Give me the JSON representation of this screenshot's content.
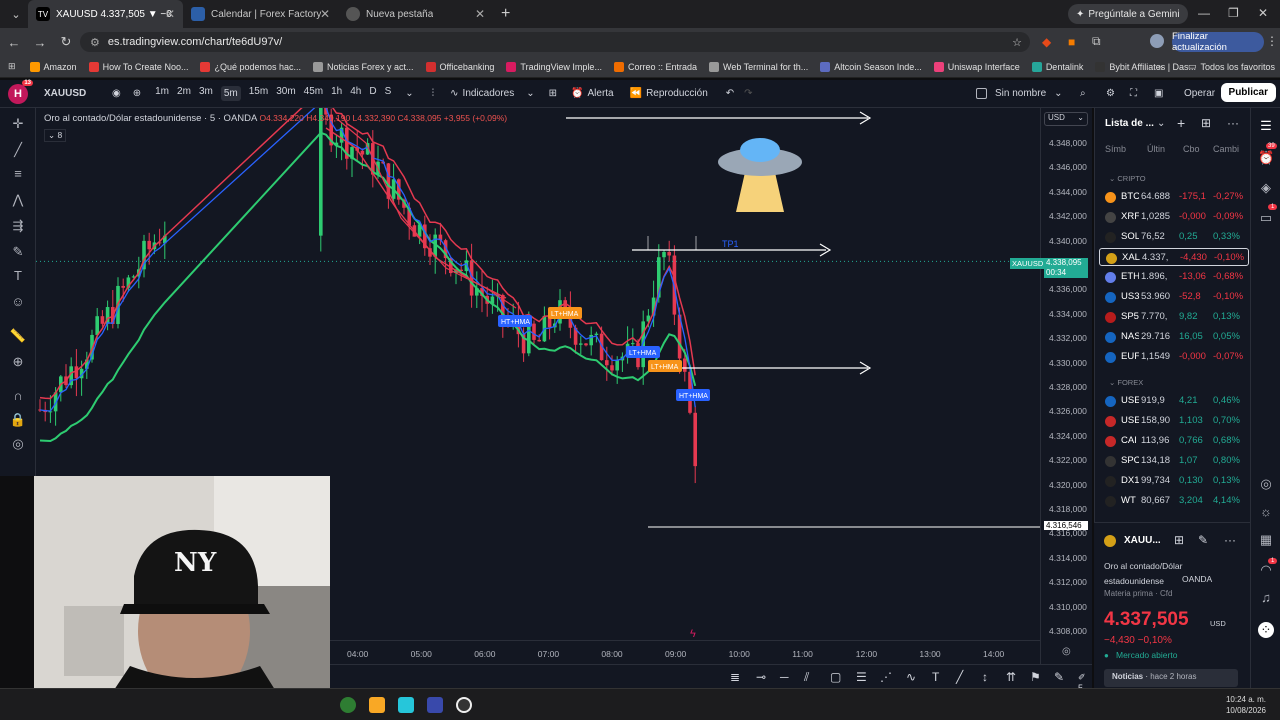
{
  "browser": {
    "tabs": [
      {
        "label": "XAUUSD 4.337,505 ▼ −0.1% Si",
        "active": true,
        "color": "#fff"
      },
      {
        "label": "Calendar | Forex Factory",
        "active": false,
        "color": "#2c5fa8"
      },
      {
        "label": "Nueva pestaña",
        "active": false,
        "color": "#777"
      }
    ],
    "new_tab": "+",
    "gemini": "Pregúntale a Gemini",
    "url": "es.tradingview.com/chart/te6dU97v/",
    "update_btn": "Finalizar actualización",
    "bookmarks": [
      {
        "label": "Amazon",
        "color": "#ff9900"
      },
      {
        "label": "How To Create Noo...",
        "color": "#e53935"
      },
      {
        "label": "¿Qué podemos hac...",
        "color": "#e53935"
      },
      {
        "label": "Noticias Forex y act...",
        "color": "#999"
      },
      {
        "label": "Officebanking",
        "color": "#d32f2f"
      },
      {
        "label": "TradingView Imple...",
        "color": "#d81b60"
      },
      {
        "label": "Correo :: Entrada",
        "color": "#ef6c00"
      },
      {
        "label": "Web Terminal for th...",
        "color": "#999"
      },
      {
        "label": "Altcoin Season Inde...",
        "color": "#5c6bc0"
      },
      {
        "label": "Uniswap Interface",
        "color": "#ec407a"
      },
      {
        "label": "Dentalink",
        "color": "#26a69a"
      },
      {
        "label": "Bybit Affiliates | Das...",
        "color": "#333"
      }
    ],
    "all_bookmarks": "Todos los favoritos"
  },
  "tv": {
    "logo": "H",
    "logo_badge": "13",
    "symbol": "XAUUSD",
    "timeframes": [
      "1m",
      "2m",
      "3m",
      "5m",
      "15m",
      "30m",
      "45m",
      "1h",
      "4h",
      "D",
      "S"
    ],
    "selected_tf": "5m",
    "indicators": "Indicadores",
    "alert": "Alerta",
    "replay": "Reproducción",
    "layout_name": "Sin nombre",
    "operate": "Operar",
    "publish": "Publicar"
  },
  "chart": {
    "legend_title": "Oro al contado/Dólar estadounidense · 5 · OANDA",
    "ohlc": "O4.334,220 H4.340,190 L4.332,390 C4.338,095 +3,955 (+0,09%)",
    "indicator_count": "8",
    "currency": "USD",
    "price_labels": [
      "4.348,000",
      "4.346,000",
      "4.344,000",
      "4.342,000",
      "4.340,000",
      "4.338,000",
      "4.336,000",
      "4.334,000",
      "4.332,000",
      "4.330,000",
      "4.328,000",
      "4.326,000",
      "4.324,000",
      "4.322,000",
      "4.320,000",
      "4.318,000",
      "4.316,000",
      "4.314,000",
      "4.312,000",
      "4.310,000",
      "4.308,000"
    ],
    "current_price": "4.338,095",
    "countdown": "00:34",
    "symbol_tag": "XAUUSD",
    "low_line_price": "4.316,546",
    "time_labels": [
      "04:00",
      "05:00",
      "06:00",
      "07:00",
      "08:00",
      "09:00",
      "10:00",
      "11:00",
      "12:00",
      "13:00",
      "14:00"
    ],
    "tp_label": "TP1",
    "labels": [
      {
        "text": "HT+HMA",
        "color": "#2962ff"
      },
      {
        "text": "LT+HMA",
        "color": "#f7931a"
      },
      {
        "text": "LT+HMA",
        "color": "#2962ff"
      },
      {
        "text": "LT+HMA",
        "color": "#f7931a"
      },
      {
        "text": "HT+HMA",
        "color": "#2962ff"
      }
    ]
  },
  "watchlist": {
    "title": "Lista de ...",
    "cols": [
      "Símb",
      "Últin",
      "Cbo",
      "Cambi"
    ],
    "sections": {
      "crypto": "CRIPTO",
      "forex": "FOREX"
    },
    "rows": [
      {
        "sym": "BTC",
        "last": "64.688",
        "chg": "-175,1",
        "pct": "-0,27%",
        "neg": true,
        "icon": "#f7931a"
      },
      {
        "sym": "XRF",
        "last": "1,0285",
        "chg": "-0,000",
        "pct": "-0,09%",
        "neg": true,
        "icon": "#444"
      },
      {
        "sym": "SOL",
        "last": "76,52",
        "chg": "0,25",
        "pct": "0,33%",
        "neg": false,
        "icon": "#222"
      },
      {
        "sym": "XAL",
        "last": "4.337,",
        "chg": "-4,430",
        "pct": "-0,10%",
        "neg": true,
        "icon": "#d4a017",
        "selected": true
      },
      {
        "sym": "ETH",
        "last": "1.896,",
        "chg": "-13,06",
        "pct": "-0,68%",
        "neg": true,
        "icon": "#627eea"
      },
      {
        "sym": "US3",
        "last": "53.960",
        "chg": "-52,8",
        "pct": "-0,10%",
        "neg": true,
        "icon": "#1565c0"
      },
      {
        "sym": "SP5",
        "last": "7.770,",
        "chg": "9,82",
        "pct": "0,13%",
        "neg": false,
        "icon": "#b71c1c"
      },
      {
        "sym": "NAS",
        "last": "29.716",
        "chg": "16,05",
        "pct": "0,05%",
        "neg": false,
        "icon": "#1565c0"
      },
      {
        "sym": "EUF",
        "last": "1,1549",
        "chg": "-0,000",
        "pct": "-0,07%",
        "neg": true,
        "icon": "#1565c0"
      },
      {
        "sym": "USE",
        "last": "919,9",
        "chg": "4,21",
        "pct": "0,46%",
        "neg": false,
        "icon": "#1565c0"
      },
      {
        "sym": "USE",
        "last": "158,90",
        "chg": "1,103",
        "pct": "0,70%",
        "neg": false,
        "icon": "#c62828"
      },
      {
        "sym": "CAI",
        "last": "113,96",
        "chg": "0,766",
        "pct": "0,68%",
        "neg": false,
        "icon": "#c62828"
      },
      {
        "sym": "SPC",
        "last": "134,18",
        "chg": "1,07",
        "pct": "0,80%",
        "neg": false,
        "icon": "#333"
      },
      {
        "sym": "DX1",
        "last": "99,734",
        "chg": "0,130",
        "pct": "0,13%",
        "neg": false,
        "icon": "#222"
      },
      {
        "sym": "WT",
        "last": "80,667",
        "chg": "3,204",
        "pct": "4,14%",
        "neg": false,
        "icon": "#222"
      }
    ]
  },
  "details": {
    "sym": "XAUU...",
    "name": "Oro al contado/Dólar estadounidense",
    "exchange": "OANDA",
    "category": "Materia prima · Cfd",
    "price": "4.337,505",
    "currency": "USD",
    "change": "−4,430 −0,10%",
    "status": "Mercado abierto",
    "news": "Noticias",
    "news_time": "hace 2 horas"
  },
  "taskbar": {
    "time": "10:24 a. m.",
    "date": "10/08/2026"
  },
  "badges": {
    "alerts": "39",
    "chat": "1",
    "bell": "1"
  },
  "drawbar_count": "5"
}
